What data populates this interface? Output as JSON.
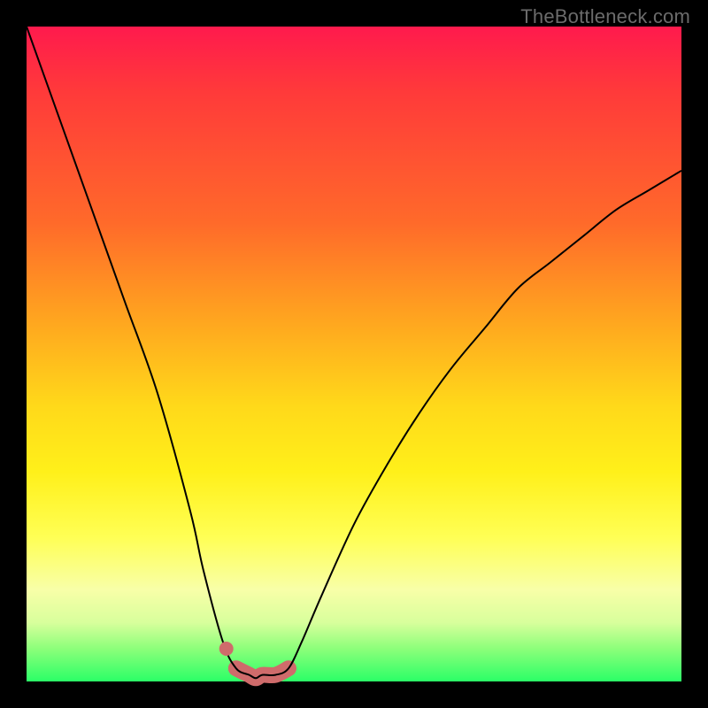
{
  "watermark": "TheBottleneck.com",
  "chart_data": {
    "type": "line",
    "title": "",
    "xlabel": "",
    "ylabel": "",
    "xlim": [
      0,
      100
    ],
    "ylim": [
      0,
      100
    ],
    "series": [
      {
        "name": "bottleneck-curve",
        "x": [
          0,
          5,
          10,
          15,
          20,
          25,
          27,
          30,
          32,
          34,
          35,
          36,
          38,
          40,
          42,
          45,
          50,
          55,
          60,
          65,
          70,
          75,
          80,
          85,
          90,
          95,
          100
        ],
        "values": [
          100,
          86,
          72,
          58,
          44,
          26,
          17,
          6,
          2,
          1,
          0.5,
          1,
          1,
          2,
          6,
          13,
          24,
          33,
          41,
          48,
          54,
          60,
          64,
          68,
          72,
          75,
          78
        ]
      }
    ],
    "highlight": {
      "name": "bottleneck-flat-zone",
      "x_range": [
        32,
        41
      ],
      "stroke_color": "#cf6b6b",
      "stroke_width": 18
    },
    "marker": {
      "name": "bottleneck-dot",
      "x": 30.5,
      "y": 5,
      "radius": 8,
      "color": "#cf6b6b"
    },
    "background_gradient": {
      "top": "#ff1a4d",
      "bottom": "#2bff67"
    }
  }
}
